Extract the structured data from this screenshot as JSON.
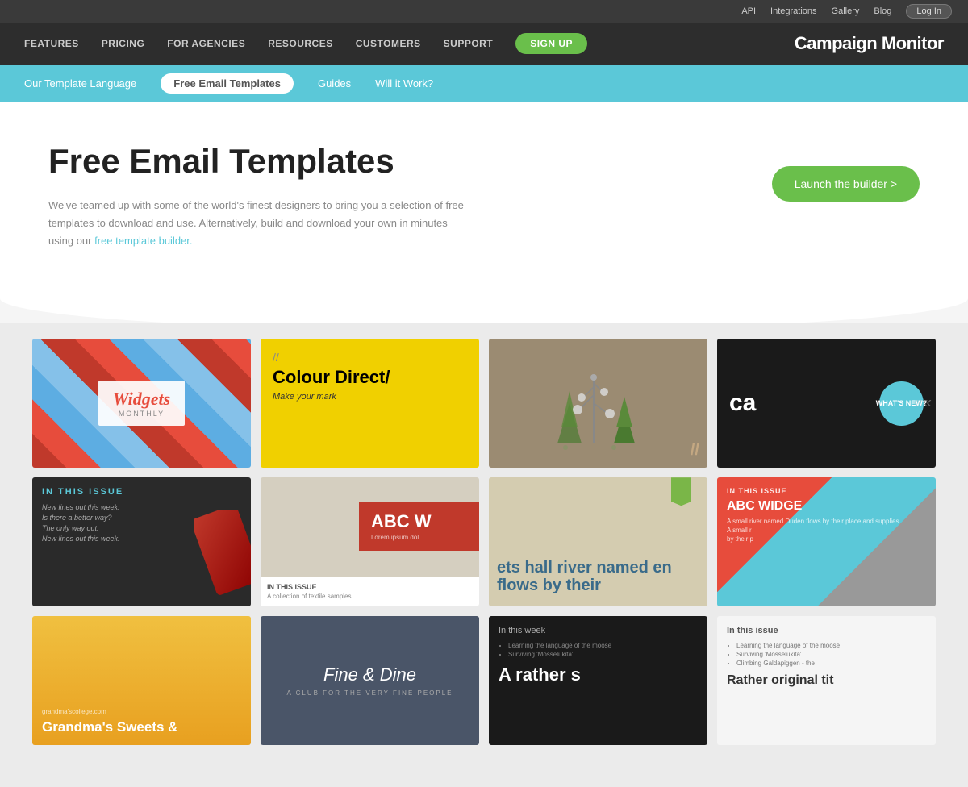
{
  "topbar": {
    "links": [
      "API",
      "Integrations",
      "Gallery",
      "Blog"
    ],
    "login": "Log In"
  },
  "mainnav": {
    "links": [
      "FEATURES",
      "PRICING",
      "FOR AGENCIES",
      "RESOURCES",
      "CUSTOMERS",
      "SUPPORT"
    ],
    "signup": "SIGN UP",
    "brand": "Campaign Monitor"
  },
  "subnav": {
    "links": [
      "Our Template Language",
      "Free Email Templates",
      "Guides",
      "Will it Work?"
    ],
    "active": "Free Email Templates"
  },
  "hero": {
    "title": "Free Email Templates",
    "description": "We've teamed up with some of the world's finest designers to bring you a selection of free templates to download and use. Alternatively, build and download your own in minutes using our",
    "link_text": "free template builder.",
    "launch_btn": "Launch the builder >"
  },
  "templates": {
    "row1": [
      {
        "id": "widgets",
        "title": "Widgets",
        "subtitle": "Monthly"
      },
      {
        "id": "colour",
        "tagline": "//",
        "title": "Colour Direct/",
        "sub": "Make your mark"
      },
      {
        "id": "nature",
        "slash": "//"
      },
      {
        "id": "dark",
        "text": "ca",
        "badge_line1": "WHAT'S",
        "badge_line2": "NEW?"
      }
    ],
    "row2": [
      {
        "id": "skate",
        "header": "IN THIS ISSUE",
        "items": [
          "New lines out this week.",
          "Is there a better way?",
          "The only way out.",
          "New lines out this week."
        ]
      },
      {
        "id": "abc",
        "header": "IN THIS ISSUE",
        "sub": "A collection of textile samples",
        "letters": "ABC W",
        "lorem": "Lorem ipsum dol"
      },
      {
        "id": "river",
        "title": "ets hall river named en flows by their"
      },
      {
        "id": "abc2",
        "header": "IN THIS ISSUE",
        "title": "ABC WIDGE",
        "items": [
          "A small river named Duden flows by their place and supplies",
          "A small r",
          "by their p"
        ]
      }
    ],
    "row3": [
      {
        "id": "grandma",
        "url": "grandma'scollege.com",
        "title": "Grandma's Sweets &"
      },
      {
        "id": "fine",
        "title": "Fine & Dine",
        "sub": "A CLUB FOR THE VERY FINE PEOPLE"
      },
      {
        "id": "week",
        "header": "In this week",
        "items": [
          "Learning the language of the moose",
          "Surviving 'Mosselukita'"
        ],
        "title": "A rather s"
      },
      {
        "id": "issue",
        "header": "In this issue",
        "items": [
          "Learning the language of the moose",
          "Surviving 'Mosselukita'",
          "Climbing Galdapiggen - the"
        ],
        "title": "Rather original tit"
      }
    ]
  },
  "colors": {
    "accent_green": "#6abf4b",
    "accent_cyan": "#5bc8d8",
    "nav_dark": "#2d2d2d",
    "topbar_dark": "#3a3a3a"
  }
}
